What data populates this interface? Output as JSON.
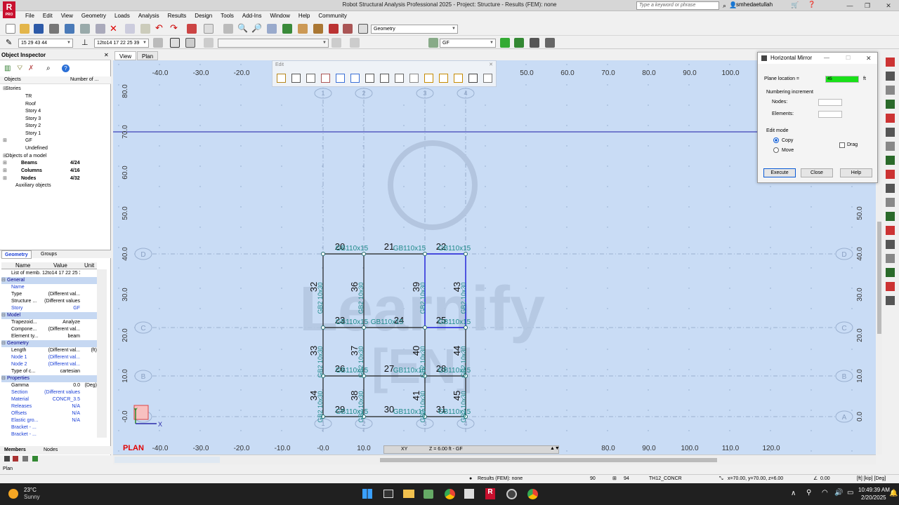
{
  "window": {
    "title": "Robot Structural Analysis Professional 2025 - Project: Structure - Results (FEM): none",
    "search_placeholder": "Type a keyword or phrase",
    "user": "smhedaetullah"
  },
  "menu": [
    "File",
    "Edit",
    "View",
    "Geometry",
    "Loads",
    "Analysis",
    "Results",
    "Design",
    "Tools",
    "Add-Ins",
    "Window",
    "Help",
    "Community"
  ],
  "toolbar": {
    "layout_combo": "Geometry",
    "selection_combo_1": "15 29 43 44",
    "selection_combo_2": "12to14 17 22 25 39",
    "story_combo": "GF"
  },
  "inspector": {
    "title": "Object Inspector",
    "col_objects": "Objects",
    "col_number": "Number of ...",
    "tree": {
      "stories": "Stories",
      "items": [
        "TR",
        "Roof",
        "Story 4",
        "Story 3",
        "Story 2",
        "Story 1",
        "GF",
        "Undefined"
      ],
      "objects_of_model": "Objects of a model",
      "beams": {
        "label": "Beams",
        "count": "4/24"
      },
      "columns": {
        "label": "Columns",
        "count": "4/16"
      },
      "nodes": {
        "label": "Nodes",
        "count": "4/32"
      },
      "aux": "Auxiliary objects"
    },
    "tab_geometry": "Geometry",
    "tab_groups": "Groups",
    "props_header": {
      "name": "Name",
      "value": "Value",
      "unit": "Unit"
    },
    "props": [
      {
        "n": "List of memb...",
        "v": "12to14 17 22 25 3...",
        "u": "",
        "cls": ""
      },
      {
        "n": "General",
        "v": "",
        "u": "",
        "cls": "sec"
      },
      {
        "n": "Name",
        "v": "",
        "u": "",
        "cls": "hl"
      },
      {
        "n": "Type",
        "v": "(Different val...",
        "u": "",
        "cls": ""
      },
      {
        "n": "Structure ...",
        "v": "(Different values",
        "u": "",
        "cls": ""
      },
      {
        "n": "Story",
        "v": "GF",
        "u": "",
        "cls": "hl"
      },
      {
        "n": "Model",
        "v": "",
        "u": "",
        "cls": "sec"
      },
      {
        "n": "Trapezoid...",
        "v": "Analyze",
        "u": "",
        "cls": ""
      },
      {
        "n": "Compone...",
        "v": "(Different val...",
        "u": "",
        "cls": ""
      },
      {
        "n": "Element ty...",
        "v": "beam",
        "u": "",
        "cls": ""
      },
      {
        "n": "Geometry",
        "v": "",
        "u": "",
        "cls": "sec"
      },
      {
        "n": "Length",
        "v": "(Different val...",
        "u": "(ft)",
        "cls": ""
      },
      {
        "n": "Node 1",
        "v": "(Different val...",
        "u": "",
        "cls": "hl"
      },
      {
        "n": "Node 2",
        "v": "(Different val...",
        "u": "",
        "cls": "hl"
      },
      {
        "n": "Type of c...",
        "v": "cartesian",
        "u": "",
        "cls": ""
      },
      {
        "n": "Properties",
        "v": "",
        "u": "",
        "cls": "sec"
      },
      {
        "n": "Gamma",
        "v": "0.0",
        "u": "(Deg)",
        "cls": ""
      },
      {
        "n": "Section",
        "v": "(Different values",
        "u": "",
        "cls": "hl"
      },
      {
        "n": "Material",
        "v": "CONCR_3.5",
        "u": "",
        "cls": "hl"
      },
      {
        "n": "Releases",
        "v": "N/A",
        "u": "",
        "cls": "hl"
      },
      {
        "n": "Offsets",
        "v": "N/A",
        "u": "",
        "cls": "hl"
      },
      {
        "n": "Elastic gro...",
        "v": "N/A",
        "u": "",
        "cls": "hl"
      },
      {
        "n": "Bracket - ...",
        "v": "",
        "u": "",
        "cls": "hl"
      },
      {
        "n": "Bracket - ...",
        "v": "",
        "u": "",
        "cls": "hl"
      }
    ],
    "tab_members": "Members",
    "tab_nodes": "Nodes"
  },
  "view_tabs": [
    "View",
    "Plan"
  ],
  "edit_toolbar_label": "Edit",
  "canvas": {
    "x_ticks": [
      "-40.0",
      "-30.0",
      "-20.0",
      "50.0",
      "60.0",
      "70.0",
      "80.0",
      "90.0",
      "100.0"
    ],
    "x_ticks_bottom": [
      "-40.0",
      "-30.0",
      "-20.0",
      "-10.0",
      "-0.0",
      "10.0",
      "80.0",
      "90.0",
      "100.0",
      "110.0",
      "120.0"
    ],
    "y_ticks": [
      "80.0",
      "70.0",
      "60.0",
      "50.0",
      "40.0",
      "30.0",
      "20.0",
      "10.0",
      "-0.0"
    ],
    "y_ticks_right": [
      "50.0",
      "40.0",
      "30.0",
      "20.0",
      "10.0",
      "0.0"
    ],
    "grid_cols": [
      "1",
      "2",
      "3",
      "4"
    ],
    "grid_rows": [
      "D",
      "C",
      "B",
      "A"
    ],
    "node_labels": [
      "20",
      "21",
      "22",
      "23",
      "24",
      "25",
      "26",
      "27",
      "28",
      "29",
      "30",
      "31"
    ],
    "bar_labels": [
      "32",
      "36",
      "39",
      "43",
      "33",
      "37",
      "40",
      "44",
      "34",
      "38",
      "41",
      "45"
    ],
    "section_label": "GB110x15",
    "col_section_label": "GB2 10x30",
    "view_name": "PLAN",
    "watermark": "Learnify",
    "watermark_sub": "[EN]",
    "coord_xy": "XY",
    "coord_z": "Z = 6.00 ft - GF"
  },
  "dialog": {
    "title": "Horizontal Mirror",
    "plane_label": "Plane location =",
    "plane_value": "45",
    "plane_unit": "ft",
    "numbering": "Numbering increment",
    "nodes": "Nodes:",
    "elements": "Elements:",
    "edit_mode": "Edit mode",
    "copy": "Copy",
    "move": "Move",
    "drag": "Drag",
    "execute": "Execute",
    "close": "Close",
    "help": "Help"
  },
  "status": {
    "results": "Results (FEM): none",
    "n1": "90",
    "n2": "94",
    "section": "TH12_CONCR",
    "coords": "x=70.00, y=70.00, z=6.00",
    "angle": "0.00",
    "units": "[ft] [kip] [Deg]",
    "plan": "Plan"
  },
  "taskbar": {
    "temp": "23°C",
    "weather": "Sunny",
    "time": "10:49:39 AM",
    "date": "2/20/2025"
  }
}
